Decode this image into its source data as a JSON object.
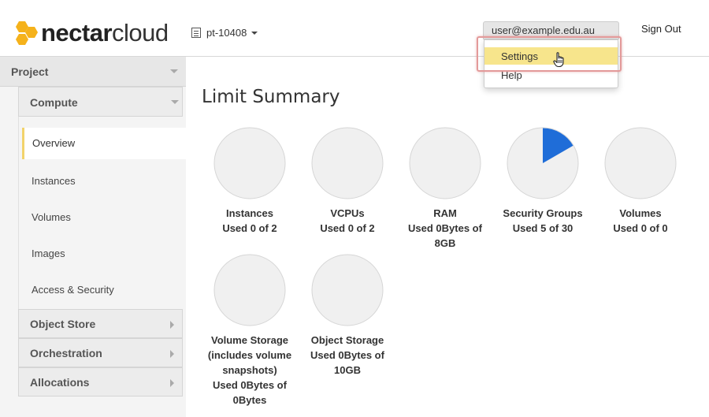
{
  "header": {
    "logo_bold": "nectar",
    "logo_light": "cloud",
    "project": "pt-10408",
    "user": "user@example.edu.au",
    "signout": "Sign Out"
  },
  "user_menu": {
    "items": [
      "Settings",
      "Help"
    ],
    "highlighted": "Settings"
  },
  "sidebar": {
    "project": "Project",
    "compute": "Compute",
    "compute_items": [
      "Overview",
      "Instances",
      "Volumes",
      "Images",
      "Access & Security"
    ],
    "active": "Overview",
    "groups": [
      "Object Store",
      "Orchestration",
      "Allocations"
    ]
  },
  "main": {
    "title": "Limit Summary"
  },
  "chart_data": {
    "type": "pie",
    "charts": [
      {
        "name": "Instances",
        "used_text": "Used 0 of 2",
        "used": 0,
        "total": 2
      },
      {
        "name": "VCPUs",
        "used_text": "Used 0 of 2",
        "used": 0,
        "total": 2
      },
      {
        "name": "RAM",
        "used_text": "Used 0Bytes of 8GB",
        "used": 0,
        "total": 8
      },
      {
        "name": "Security Groups",
        "used_text": "Used 5 of 30",
        "used": 5,
        "total": 30
      },
      {
        "name": "Volumes",
        "used_text": "Used 0 of 0",
        "used": 0,
        "total": 0
      },
      {
        "name": "Volume Storage (includes volume snapshots)",
        "used_text": "Used 0Bytes of 0Bytes",
        "used": 0,
        "total": 0
      },
      {
        "name": "Object Storage",
        "used_text": "Used 0Bytes of 10GB",
        "used": 0,
        "total": 10
      }
    ],
    "colors": {
      "empty": "#f0f0f0",
      "used": "#1f6dd8",
      "border": "#d6d6d6"
    }
  }
}
